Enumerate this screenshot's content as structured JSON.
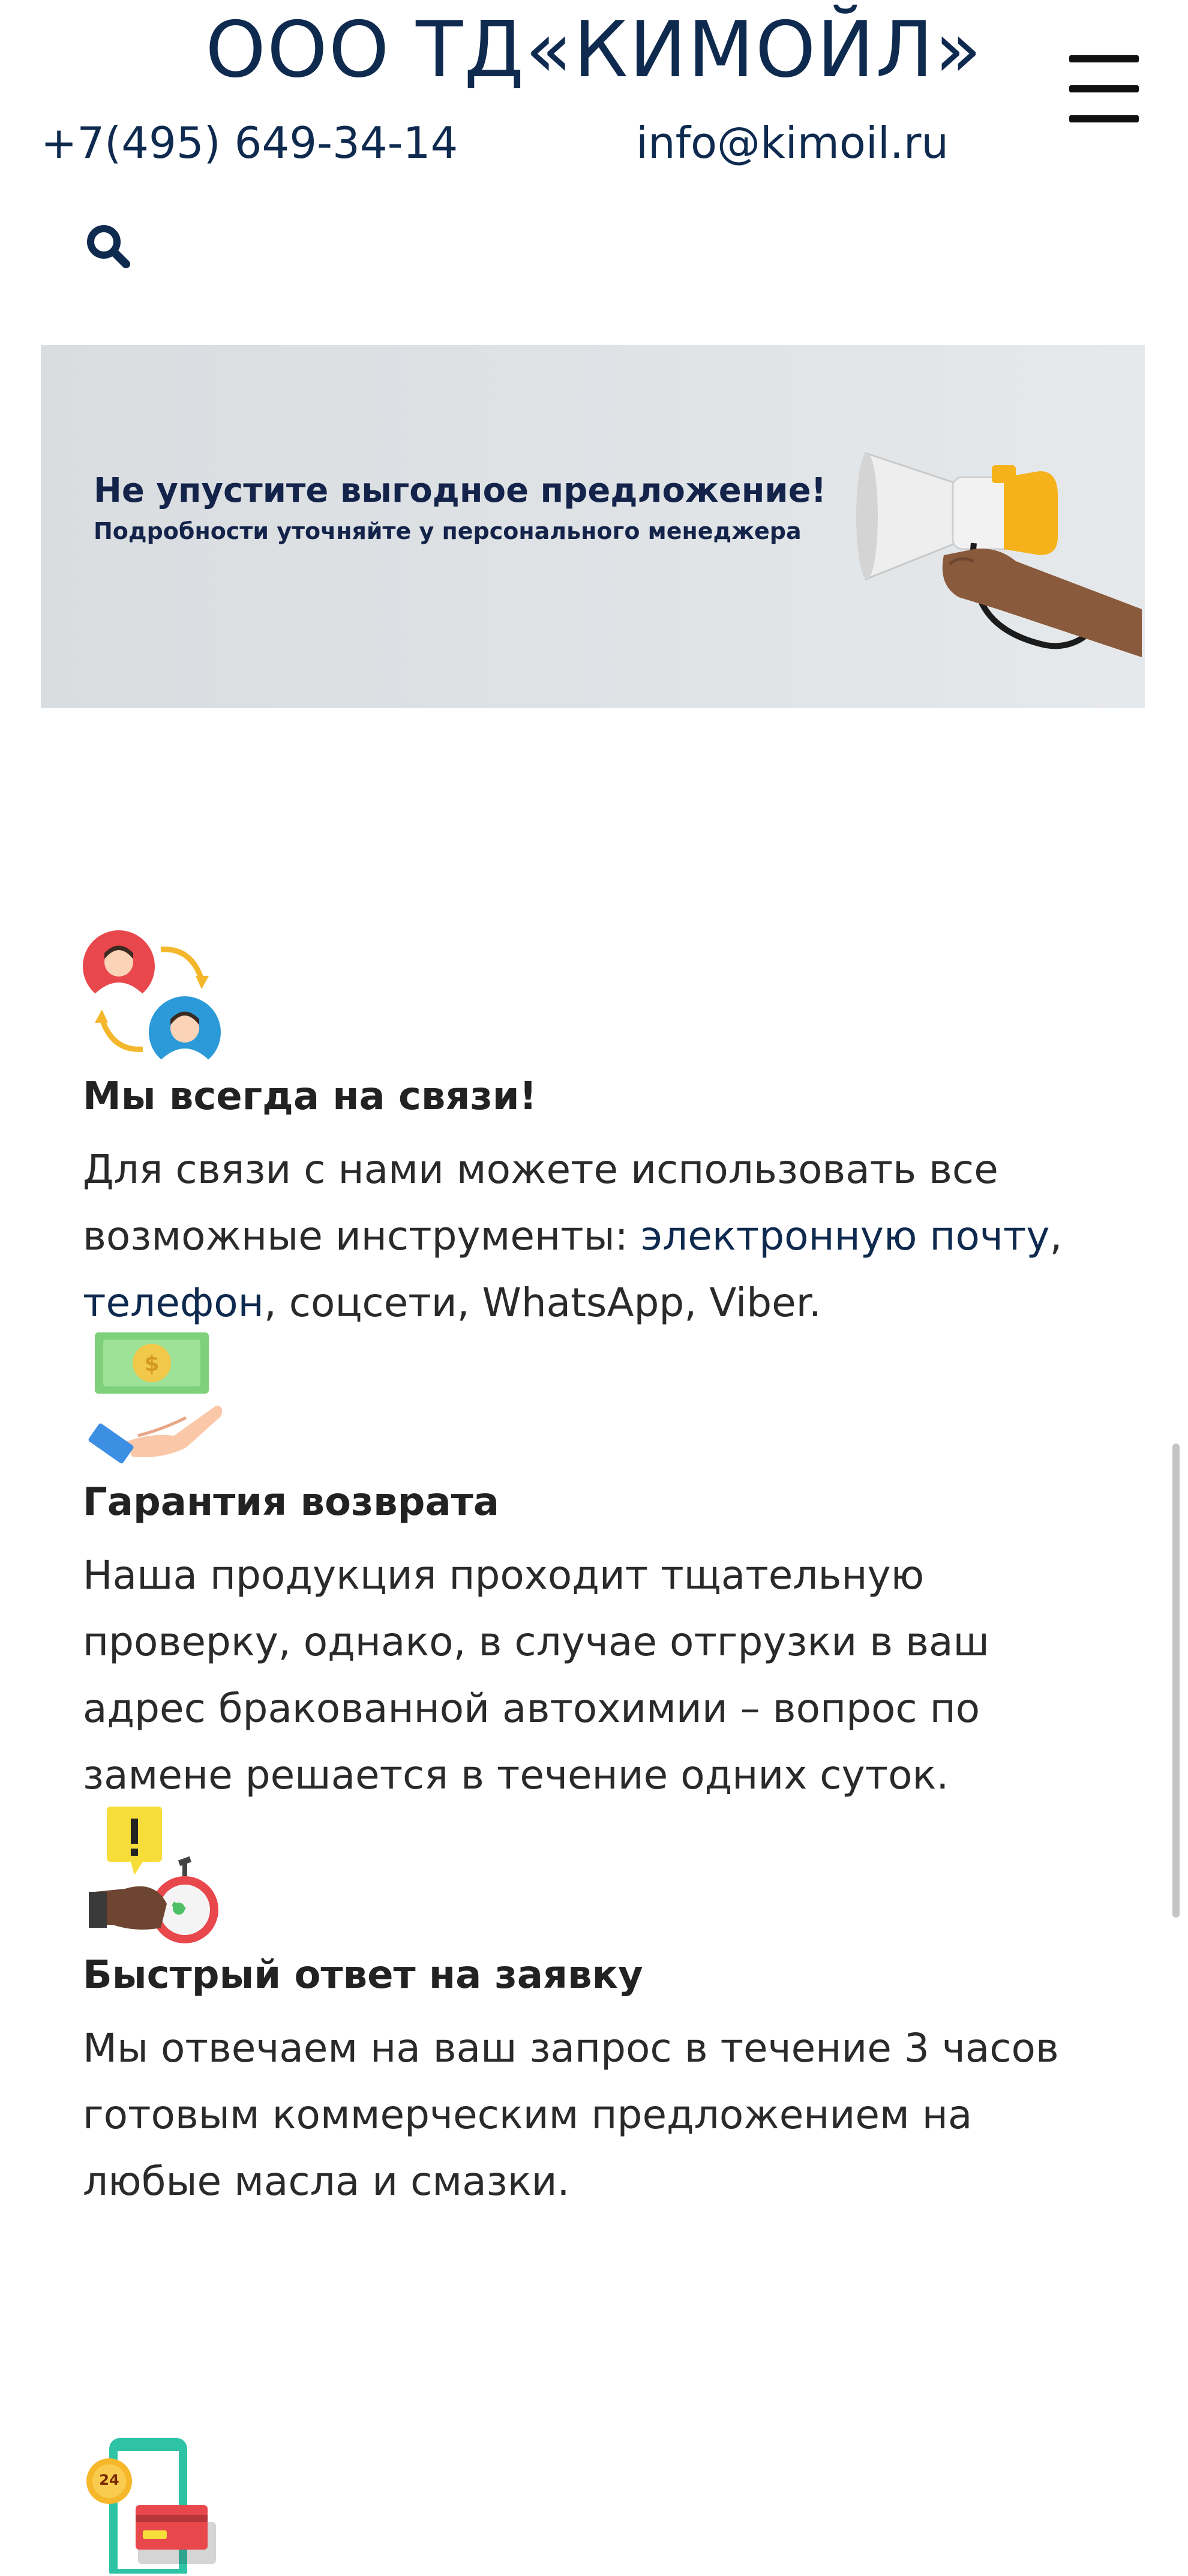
{
  "header": {
    "title": "ООО ТД«КИМОЙЛ»",
    "phone": "+7(495) 649-34-14",
    "email": "info@kimoil.ru",
    "menu_icon": "hamburger-menu-icon",
    "search_icon": "search-icon"
  },
  "banner": {
    "title": "Не упустите выгодное предложение!",
    "subtitle": "Подробности уточняйте у персонального менеджера",
    "image": "megaphone-in-hand"
  },
  "features": [
    {
      "icon": "people-exchange-icon",
      "title": "Мы всегда на связи!",
      "text_before": "Для связи с нами можете использовать все возможные инструменты: ",
      "link_email": "электронную почту",
      "sep": ", ",
      "link_phone": "телефон",
      "text_after": ", соцсети, WhatsApp, Viber."
    },
    {
      "icon": "money-in-hand-icon",
      "title": "Гарантия возврата",
      "text": "Наша продукция проходит тщательную проверку, однако, в случае отгрузки в ваш адрес бракованной автохимии – вопрос по замене решается в течение одних суток."
    },
    {
      "icon": "fast-response-stopwatch-icon",
      "title": "Быстрый ответ на заявку",
      "text": "Мы отвечаем на ваш запрос в течение 3 часов готовым коммерческим предложением на любые масла и смазки."
    },
    {
      "icon": "phone-24-card-icon",
      "badge": "24"
    }
  ],
  "colors": {
    "brand": "#0f2a4f",
    "banner_bg": "#dfe3e6",
    "text": "#2a2a2a"
  }
}
